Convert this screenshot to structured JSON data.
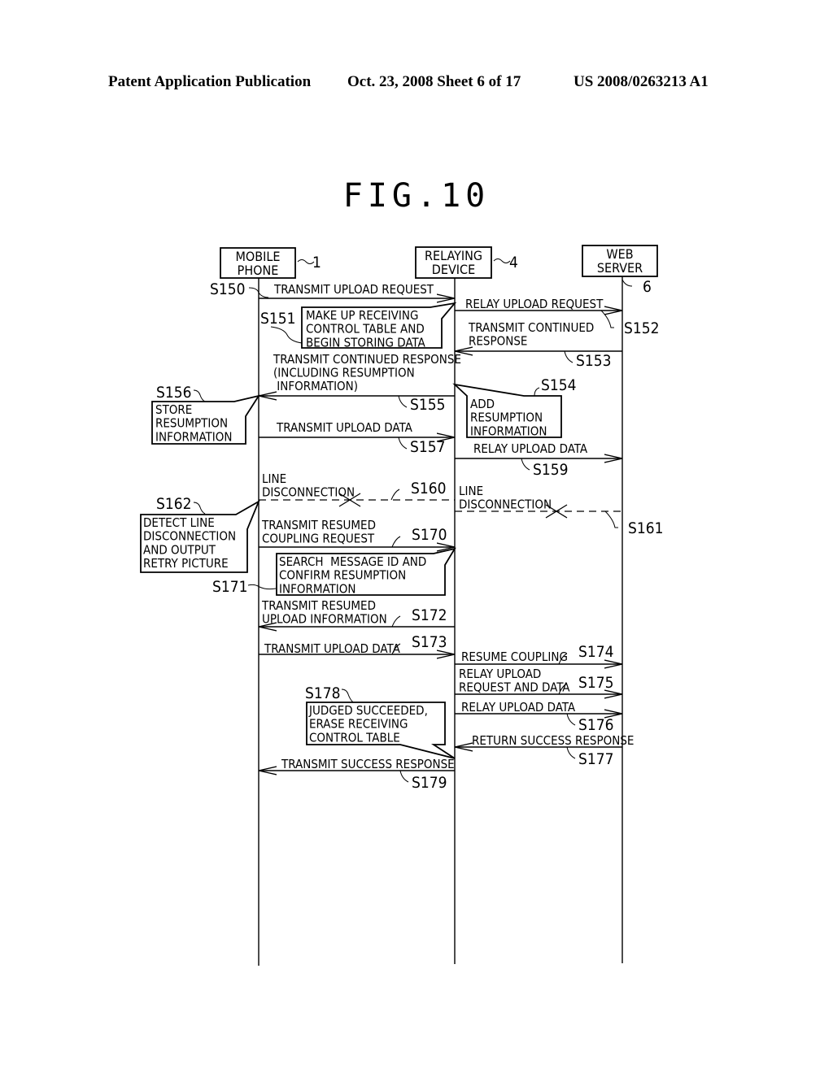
{
  "header": {
    "publication": "Patent Application Publication",
    "date_sheet": "Oct. 23, 2008   Sheet 6 of 17",
    "number": "US 2008/0263213 A1"
  },
  "figure": {
    "title": "FIG.10"
  },
  "entities": [
    {
      "id": "mobile",
      "lines": [
        "MOBILE",
        "PHONE"
      ],
      "ref": "1"
    },
    {
      "id": "relay",
      "lines": [
        "RELAYING",
        "DEVICE"
      ],
      "ref": "4"
    },
    {
      "id": "web",
      "lines": [
        "WEB",
        "SERVER"
      ],
      "ref": "6"
    }
  ],
  "messages": [
    {
      "step": "S150",
      "from": "mobile",
      "to": "relay",
      "lines": [
        "TRANSMIT UPLOAD REQUEST"
      ]
    },
    {
      "step": "S152",
      "from": "relay",
      "to": "web",
      "lines": [
        "RELAY UPLOAD REQUEST"
      ]
    },
    {
      "step": "S153",
      "from": "web",
      "to": "relay",
      "lines": [
        "TRANSMIT CONTINUED",
        "RESPONSE"
      ]
    },
    {
      "step": "S155",
      "from": "relay",
      "to": "mobile",
      "lines": [
        "TRANSMIT CONTINUED RESPONSE",
        "(INCLUDING RESUMPTION",
        " INFORMATION)"
      ]
    },
    {
      "step": "S157",
      "from": "mobile",
      "to": "relay",
      "lines": [
        "TRANSMIT UPLOAD DATA"
      ]
    },
    {
      "step": "S159",
      "from": "relay",
      "to": "web",
      "lines": [
        "RELAY UPLOAD DATA"
      ]
    },
    {
      "step": "S160",
      "from": "mobile",
      "to": "relay",
      "type": "disconnection",
      "lines": [
        "LINE",
        "DISCONNECTION"
      ]
    },
    {
      "step": "S161",
      "from": "relay",
      "to": "web",
      "type": "disconnection",
      "lines": [
        "LINE",
        "DISCONNECTION"
      ]
    },
    {
      "step": "S170",
      "from": "mobile",
      "to": "relay",
      "lines": [
        "TRANSMIT RESUMED",
        "COUPLING REQUEST"
      ]
    },
    {
      "step": "S172",
      "from": "relay",
      "to": "mobile",
      "lines": [
        "TRANSMIT RESUMED",
        "UPLOAD INFORMATION"
      ]
    },
    {
      "step": "S173",
      "from": "mobile",
      "to": "relay",
      "lines": [
        "TRANSMIT UPLOAD DATA"
      ]
    },
    {
      "step": "S174",
      "from": "relay",
      "to": "web",
      "lines": [
        "RESUME COUPLING"
      ]
    },
    {
      "step": "S175",
      "from": "relay",
      "to": "web",
      "lines": [
        "RELAY UPLOAD",
        "REQUEST AND DATA"
      ]
    },
    {
      "step": "S176",
      "from": "relay",
      "to": "web",
      "lines": [
        "RELAY UPLOAD DATA"
      ]
    },
    {
      "step": "S177",
      "from": "web",
      "to": "relay",
      "lines": [
        "RETURN SUCCESS RESPONSE"
      ]
    },
    {
      "step": "S179",
      "from": "relay",
      "to": "mobile",
      "lines": [
        "TRANSMIT SUCCESS RESPONSE"
      ]
    }
  ],
  "notes": [
    {
      "step": "S151",
      "lines": [
        "MAKE UP RECEIVING",
        "CONTROL TABLE AND",
        "BEGIN STORING DATA"
      ]
    },
    {
      "step": "S154",
      "lines": [
        "ADD",
        "RESUMPTION",
        "INFORMATION"
      ]
    },
    {
      "step": "S156",
      "lines": [
        "STORE",
        "RESUMPTION",
        "INFORMATION"
      ]
    },
    {
      "step": "S162",
      "lines": [
        "DETECT LINE",
        "DISCONNECTION",
        "AND OUTPUT",
        "RETRY PICTURE"
      ]
    },
    {
      "step": "S171",
      "lines": [
        "SEARCH  MESSAGE ID AND",
        "CONFIRM RESUMPTION",
        "INFORMATION"
      ]
    },
    {
      "step": "S178",
      "lines": [
        "JUDGED SUCCEEDED,",
        "ERASE RECEIVING",
        "CONTROL TABLE"
      ]
    }
  ]
}
